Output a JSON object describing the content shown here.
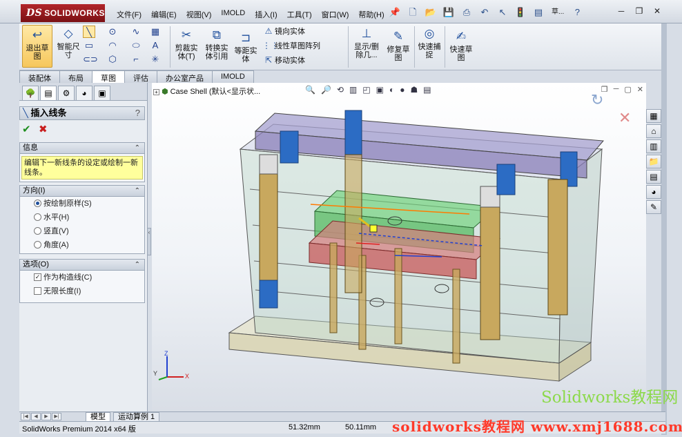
{
  "app": {
    "logo_text": "SOLIDWORKS",
    "logo_prefix": "DS"
  },
  "menu": [
    "文件(F)",
    "编辑(E)",
    "视图(V)",
    "IMOLD",
    "插入(I)",
    "工具(T)",
    "窗口(W)",
    "帮助(H)"
  ],
  "quickbar": {
    "search_label": "草..."
  },
  "command_manager": {
    "exit_sketch": "退出草图",
    "smart_dimension": "智能尺寸",
    "trim": "剪裁实体(T)",
    "convert": "转换实体引用",
    "offset": "等距实体",
    "mirror": "镜向实体",
    "linear_pattern": "线性草图阵列",
    "move": "移动实体",
    "display_delete": "显示/删除几...",
    "repair": "修复草图",
    "quick_snaps": "快速捕捉",
    "rapid_sketch": "快速草图"
  },
  "tabs": [
    "装配体",
    "布局",
    "草图",
    "评估",
    "办公室产品",
    "IMOLD"
  ],
  "active_tab_index": 2,
  "property_manager": {
    "title": "插入线条",
    "help": "?",
    "info_group": {
      "label": "信息",
      "text": "编辑下一新线条的设定或绘制一新线条。"
    },
    "direction_group": {
      "label": "方向(I)",
      "options": [
        "按绘制原样(S)",
        "水平(H)",
        "竖直(V)",
        "角度(A)"
      ],
      "selected_index": 0
    },
    "options_group": {
      "label": "选项(O)",
      "items": [
        {
          "label": "作为构造线(C)",
          "checked": true
        },
        {
          "label": "无限长度(I)",
          "checked": false
        }
      ]
    }
  },
  "graphics": {
    "tree_item": "Case Shell",
    "tree_config": "(默认<显示状...",
    "triad_x": "X",
    "triad_y": "Y",
    "triad_z": "Z"
  },
  "bottom_tabs": {
    "model": "模型",
    "motion": "运动算例 1"
  },
  "status": {
    "product": "SolidWorks Premium 2014 x64 版",
    "x": "51.32mm",
    "y": "50.11mm"
  },
  "watermarks": {
    "w1": "Solidworks教程网",
    "w2": "solidworks教程网 www.xmj1688.com"
  },
  "colors": {
    "pillar_blue": "#2c6cc4",
    "pillar_tan": "#c8a85e",
    "plate_purple": "#8a7fb8",
    "core_green": "#4fb85a",
    "core_red": "#c85a5a",
    "watermark_green": "#8cd94a",
    "watermark_red": "#ff3a2a"
  }
}
